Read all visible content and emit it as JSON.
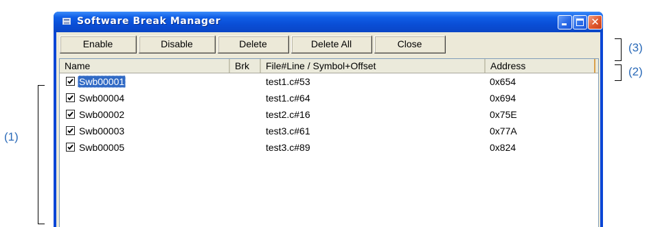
{
  "window": {
    "title": "Software Break Manager"
  },
  "toolbar": {
    "buttons": [
      {
        "label": "Enable"
      },
      {
        "label": "Disable"
      },
      {
        "label": "Delete"
      },
      {
        "label": "Delete All"
      },
      {
        "label": "Close"
      }
    ]
  },
  "list": {
    "columns": [
      "Name",
      "Brk",
      "File#Line / Symbol+Offset",
      "Address"
    ],
    "rows": [
      {
        "checked": true,
        "name": "Swb00001",
        "brk": "",
        "location": "test1.c#53",
        "address": "0x654",
        "selected": true
      },
      {
        "checked": true,
        "name": "Swb00004",
        "brk": "",
        "location": "test1.c#64",
        "address": "0x694",
        "selected": false
      },
      {
        "checked": true,
        "name": "Swb00002",
        "brk": "",
        "location": "test2.c#16",
        "address": "0x75E",
        "selected": false
      },
      {
        "checked": true,
        "name": "Swb00003",
        "brk": "",
        "location": "test3.c#61",
        "address": "0x77A",
        "selected": false
      },
      {
        "checked": true,
        "name": "Swb00005",
        "brk": "",
        "location": "test3.c#89",
        "address": "0x824",
        "selected": false
      }
    ]
  },
  "annotations": {
    "area1": "(1)",
    "area2": "(2)",
    "area3": "(3)"
  },
  "colors": {
    "title_bar": "#0a4ed6",
    "window_face": "#ece9d8",
    "selection": "#316ac5",
    "callout_text": "#2a6ab8"
  }
}
